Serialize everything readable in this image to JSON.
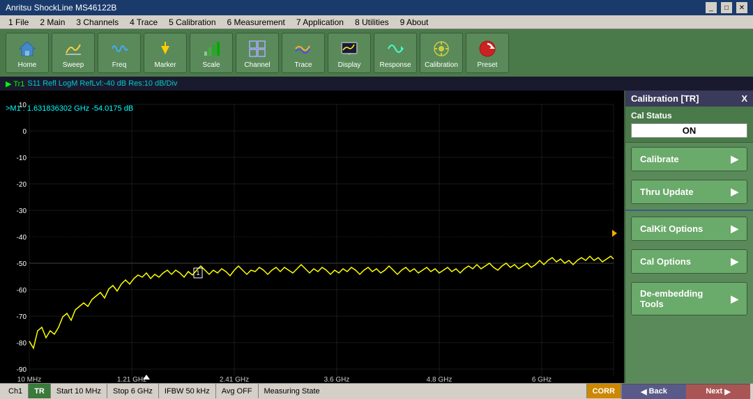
{
  "titleBar": {
    "title": "Anritsu ShockLine MS46122B",
    "controls": [
      "_",
      "□",
      "X"
    ]
  },
  "menuBar": {
    "items": [
      "1 File",
      "2 Main",
      "3 Channels",
      "4 Trace",
      "5 Calibration",
      "6 Measurement",
      "7 Application",
      "8 Utilities",
      "9 About"
    ]
  },
  "toolbar": {
    "buttons": [
      {
        "label": "Home",
        "icon": "🏠"
      },
      {
        "label": "Sweep",
        "icon": "↔"
      },
      {
        "label": "Freq",
        "icon": "≈"
      },
      {
        "label": "Marker",
        "icon": "▼"
      },
      {
        "label": "Scale",
        "icon": "📊"
      },
      {
        "label": "Channel",
        "icon": "⊞"
      },
      {
        "label": "Trace",
        "icon": "〰"
      },
      {
        "label": "Display",
        "icon": "🖥"
      },
      {
        "label": "Response",
        "icon": "⟳"
      },
      {
        "label": "Calibration",
        "icon": "⚙"
      },
      {
        "label": "Preset",
        "icon": "↺"
      }
    ]
  },
  "traceInfo": {
    "trLabel": "▶ Tr1",
    "info": "S11 Refl LogM RefLvl:-40 dB Res:10 dB/Div"
  },
  "markerInfo": {
    "text": ">M1 : 1.631836302 GHz -54.0175 dB"
  },
  "plot": {
    "yLabels": [
      "10",
      "0",
      "-10",
      "-20",
      "-30",
      "-40",
      "-50",
      "-60",
      "-70",
      "-80",
      "-90"
    ],
    "xLabels": [
      "10 MHz",
      "1.21 GHz",
      "2.41 GHz",
      "3.6 GHz",
      "4.8 GHz",
      "6 GHz"
    ]
  },
  "calPanel": {
    "title": "Calibration [TR]",
    "closeLabel": "X",
    "calStatusLabel": "Cal Status",
    "calStatusValue": "ON",
    "buttons": [
      {
        "label": "Calibrate",
        "hasArrow": true
      },
      {
        "label": "Thru Update",
        "hasArrow": true
      },
      {
        "label": "CalKit Options",
        "hasArrow": true
      },
      {
        "label": "Cal Options",
        "hasArrow": true
      },
      {
        "label": "De-embedding\nTools",
        "hasArrow": true
      }
    ]
  },
  "statusBar": {
    "cells": [
      {
        "text": "Ch1",
        "type": "normal"
      },
      {
        "text": "TR",
        "type": "highlight"
      },
      {
        "text": "Start 10 MHz",
        "type": "normal"
      },
      {
        "text": "Stop 6 GHz",
        "type": "normal"
      },
      {
        "text": "IFBW 50 kHz",
        "type": "normal"
      },
      {
        "text": "Avg OFF",
        "type": "normal"
      },
      {
        "text": "Measuring State",
        "type": "normal"
      },
      {
        "text": "CORR",
        "type": "corr"
      }
    ]
  },
  "bottomNav": {
    "backLabel": "◀ Back",
    "nextLabel": "Next ▶"
  }
}
